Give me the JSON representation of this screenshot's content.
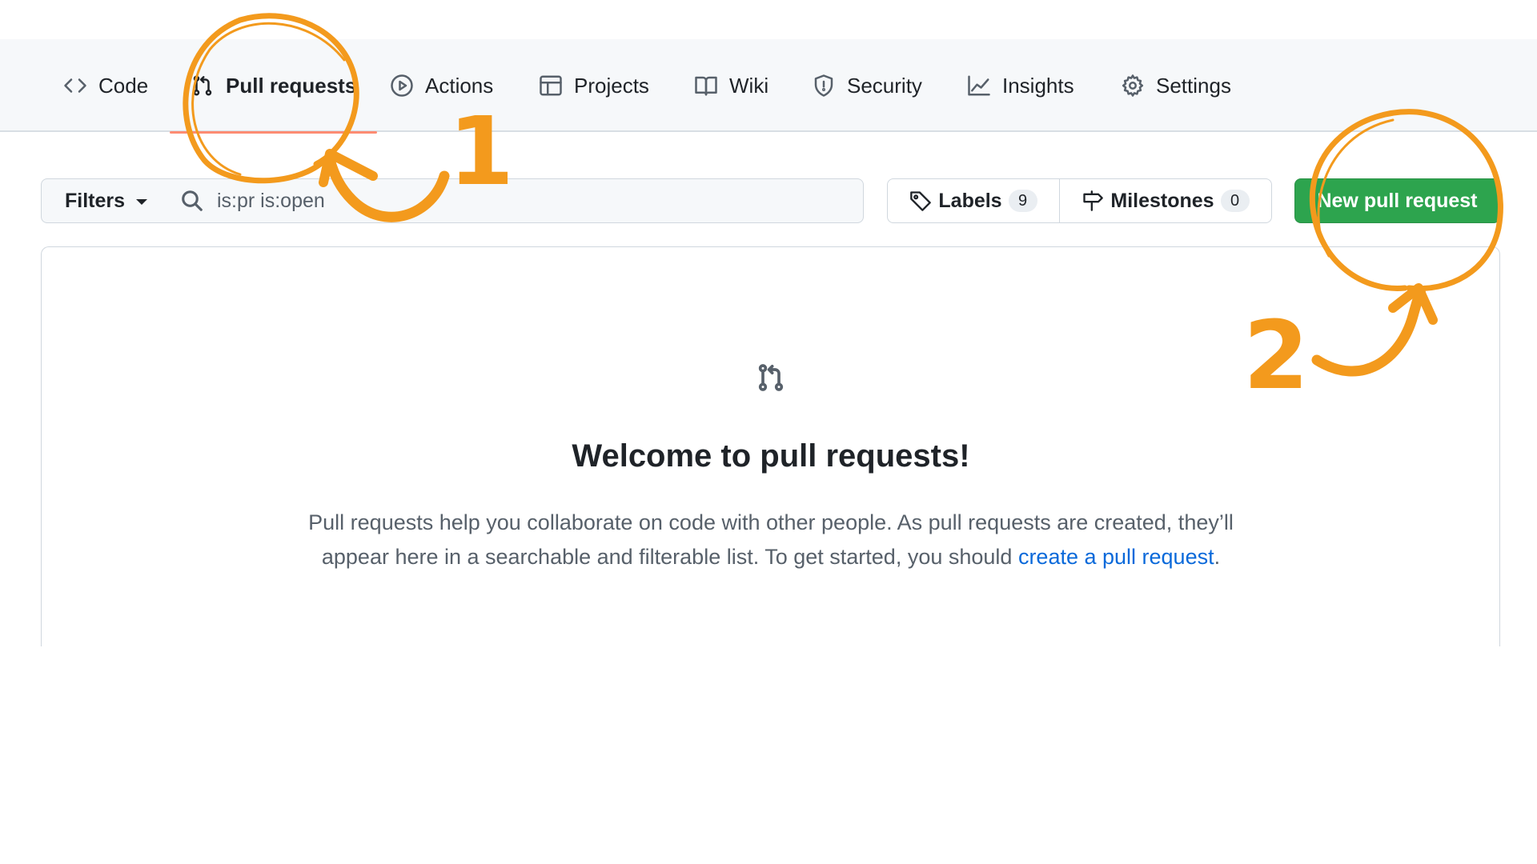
{
  "nav": {
    "tabs": [
      {
        "label": "Code",
        "icon": "code-icon"
      },
      {
        "label": "Pull requests",
        "icon": "git-pull-request-icon",
        "active": true
      },
      {
        "label": "Actions",
        "icon": "play-icon"
      },
      {
        "label": "Projects",
        "icon": "table-icon"
      },
      {
        "label": "Wiki",
        "icon": "book-icon"
      },
      {
        "label": "Security",
        "icon": "shield-icon"
      },
      {
        "label": "Insights",
        "icon": "graph-icon"
      },
      {
        "label": "Settings",
        "icon": "gear-icon"
      }
    ]
  },
  "toolbar": {
    "filters_label": "Filters",
    "search_value": "is:pr is:open",
    "labels_label": "Labels",
    "labels_count": "9",
    "milestones_label": "Milestones",
    "milestones_count": "0",
    "new_pr_label": "New pull request"
  },
  "blankslate": {
    "icon": "git-pull-request-icon",
    "title": "Welcome to pull requests!",
    "text_before_link": "Pull requests help you collaborate on code with other people. As pull requests are created, they’ll appear here in a searchable and filterable list. To get started, you should ",
    "link_text": "create a pull request",
    "text_after_link": "."
  },
  "annotations": {
    "step1": "1",
    "step2": "2",
    "color": "#f39a1d"
  },
  "colors": {
    "primary_button": "#2da44e",
    "link": "#0969da",
    "active_tab_underline": "#fd8c73"
  }
}
